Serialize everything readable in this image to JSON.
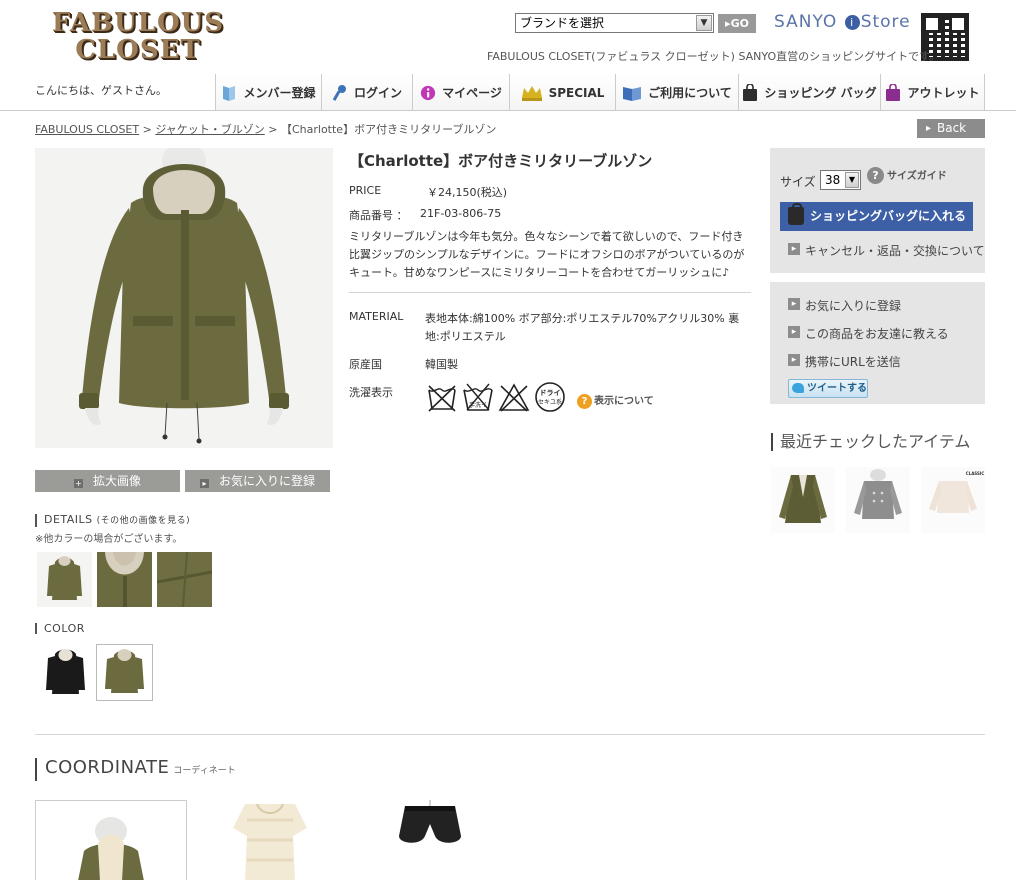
{
  "header": {
    "logo_line1": "FABULOUS",
    "logo_line2": "CLOSET",
    "brand_select_value": "ブランドを選択",
    "go_label": "GO",
    "store_logo_a": "SANYO",
    "store_logo_i": "i",
    "store_logo_b": "Store",
    "tagline": "FABULOUS CLOSET(ファビュラス クローゼット) SANYO直営のショッピングサイトです。",
    "greeting": "こんにちは、ゲストさん。"
  },
  "gnav": [
    {
      "label": "メンバー登録",
      "icon": "book-icon",
      "color": "#6aa6d8"
    },
    {
      "label": "ログイン",
      "icon": "key-icon",
      "color": "#3f73b8"
    },
    {
      "label": "マイページ",
      "icon": "info-icon",
      "color": "#c038b8"
    },
    {
      "label": "SPECIAL",
      "icon": "crown-icon",
      "color": "#d6b21f"
    },
    {
      "label": "ご利用について",
      "icon": "guide-book-icon",
      "color": "#3d6fb9"
    },
    {
      "label": "ショッピング バッグ",
      "icon": "shopping-bag-icon",
      "color": "#2c2c2c"
    },
    {
      "label": "アウトレット",
      "icon": "outlet-bag-icon",
      "color": "#8a2d8e"
    }
  ],
  "breadcrumb": {
    "home": "FABULOUS CLOSET",
    "sep1": ">",
    "category": "ジャケット・ブルゾン",
    "sep2": ">",
    "current": "【Charlotte】ボア付きミリタリーブルゾン"
  },
  "back_label": "Back",
  "product": {
    "title": "【Charlotte】ボア付きミリタリーブルゾン",
    "price_label": "PRICE",
    "price": "￥24,150(税込)",
    "sku_label": "商品番号 ：",
    "sku": "21F-03-806-75",
    "description": "ミリタリーブルゾンは今年も気分。色々なシーンで着て欲しいので、フード付き比翼ジップのシンプルなデザインに。フードにオフシロのボアがついているのがキュート。甘めなワンピースにミリタリーコートを合わせてガーリッシュに♪",
    "material_label": "MATERIAL",
    "material": "表地本体:綿100% ボア部分:ポリエステル70%アクリル30% 裏地:ポリエステル",
    "origin_label": "原産国",
    "origin": "韓国製",
    "care_label": "洗濯表示",
    "care_icons": [
      "no-wash-icon",
      "hand-wash-icon",
      "no-bleach-icon",
      "dry-clean-icon"
    ],
    "care_hand_text": "手洗イ",
    "care_dry_text": "ドライ",
    "care_dry_sub": "セキユ系",
    "care_link": "表示について"
  },
  "left": {
    "zoom_label": "拡大画像",
    "favorite_label": "お気に入りに登録",
    "details_label": "DETAILS",
    "details_sub": "(その他の画像を見る)",
    "details_note": "※他カラーの場合がございます。",
    "color_label": "COLOR",
    "swatches": [
      "black",
      "khaki"
    ],
    "selected_swatch": "khaki"
  },
  "cart": {
    "size_label": "サイズ",
    "size_value": "38",
    "size_guide": "サイズガイド",
    "add_to_bag": "ショッピングバッグに入れる",
    "cancel_link": "キャンセル・返品・交換について"
  },
  "share": {
    "favorite": "お気に入りに登録",
    "tell_friend": "この商品をお友達に教える",
    "send_url": "携帯にURLを送信",
    "tweet": "ツイートする"
  },
  "recent": {
    "title": "最近チェックしたアイテム",
    "brand_tag": "CLASSIC"
  },
  "coordinate": {
    "title": "COORDINATE",
    "subtitle": "コーディネート"
  },
  "colors": {
    "khaki": "#6b6b3f",
    "khaki_dark": "#54552f",
    "bag_button": "#3d5fa6",
    "panel": "#e5e5e5"
  }
}
